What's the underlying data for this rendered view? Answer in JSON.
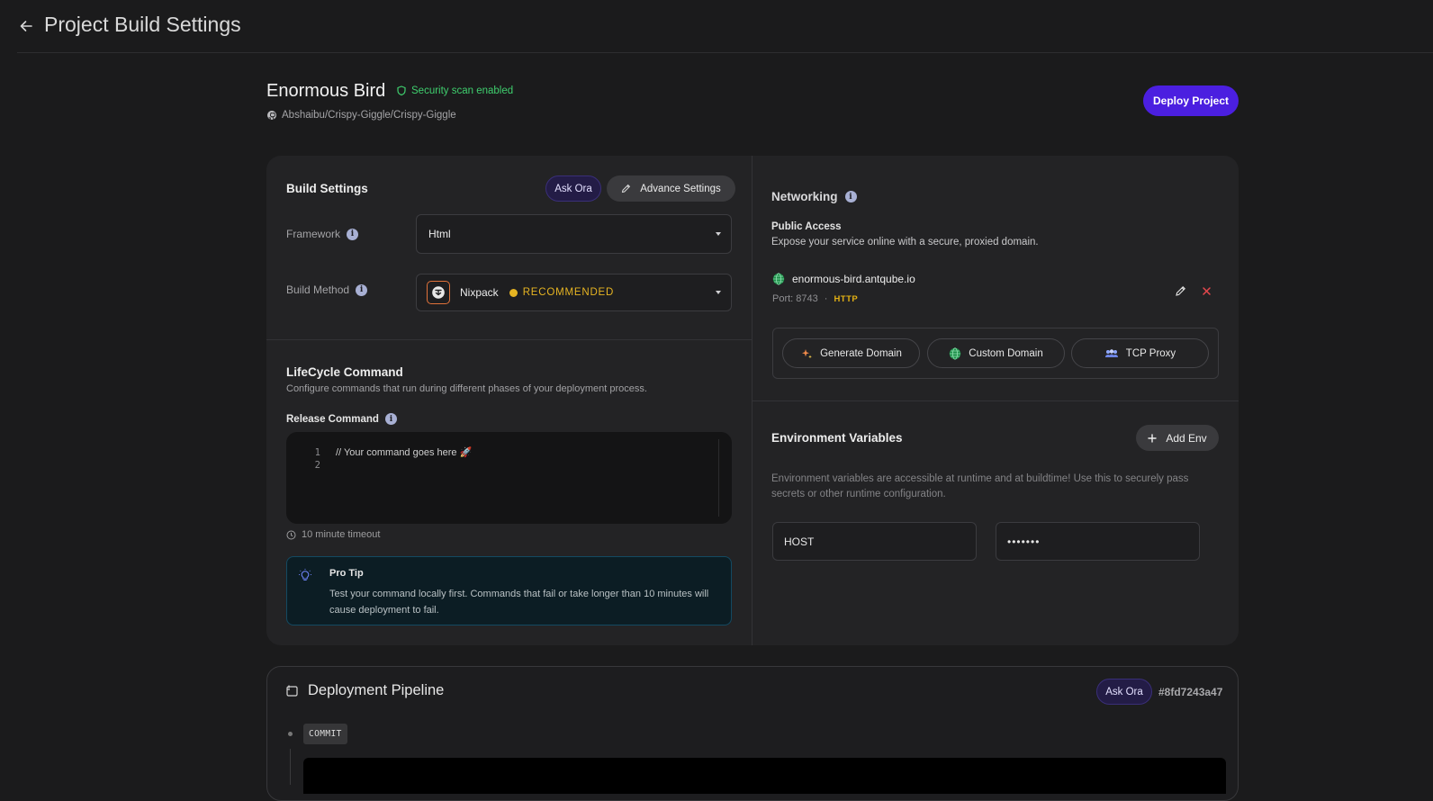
{
  "header": {
    "title": "Project Build Settings",
    "back_icon": "arrow-left-icon"
  },
  "project": {
    "name": "Enormous Bird",
    "security_badge": "Security scan enabled",
    "repo": "Abshaibu/Crispy-Giggle/Crispy-Giggle",
    "deploy_label": "Deploy Project"
  },
  "build_settings": {
    "title": "Build Settings",
    "ask_ora_label": "Ask Ora",
    "advance_label": "Advance Settings",
    "framework": {
      "label": "Framework",
      "value": "Html"
    },
    "build_method": {
      "label": "Build Method",
      "value": "Nixpack",
      "badge": "RECOMMENDED"
    }
  },
  "lifecycle": {
    "title": "LifeCycle Command",
    "description": "Configure commands that run during different phases of your deployment process.",
    "release_label": "Release Command",
    "editor": {
      "lines": [
        "1",
        "2"
      ],
      "code": "// Your command goes here 🚀"
    },
    "timeout": "10 minute timeout",
    "protip": {
      "title": "Pro Tip",
      "body": "Test your command locally first. Commands that fail or take longer than 10 minutes will cause deployment to fail."
    }
  },
  "networking": {
    "title": "Networking",
    "public_access_title": "Public Access",
    "public_access_desc": "Expose your service online with a secure, proxied domain.",
    "domain": "enormous-bird.antqube.io",
    "port": "Port: 8743",
    "separator": "·",
    "protocol": "HTTP",
    "buttons": {
      "generate": "Generate Domain",
      "custom": "Custom Domain",
      "tcp": "TCP Proxy"
    }
  },
  "env": {
    "title": "Environment Variables",
    "add_label": "Add Env",
    "description": "Environment variables are accessible at runtime and at buildtime! Use this to securely pass secrets or other runtime configuration.",
    "key": "HOST",
    "value_masked": "•••••••"
  },
  "pipeline": {
    "title": "Deployment Pipeline",
    "ask_ora_label": "Ask Ora",
    "hash": "#8fd7243a47",
    "stage": "COMMIT"
  },
  "colors": {
    "background": "#1b1b1c",
    "card": "#232325",
    "accent": "#4b1fe0",
    "success": "#3fcf6e",
    "warning": "#e6b422",
    "danger": "#e5484d"
  }
}
